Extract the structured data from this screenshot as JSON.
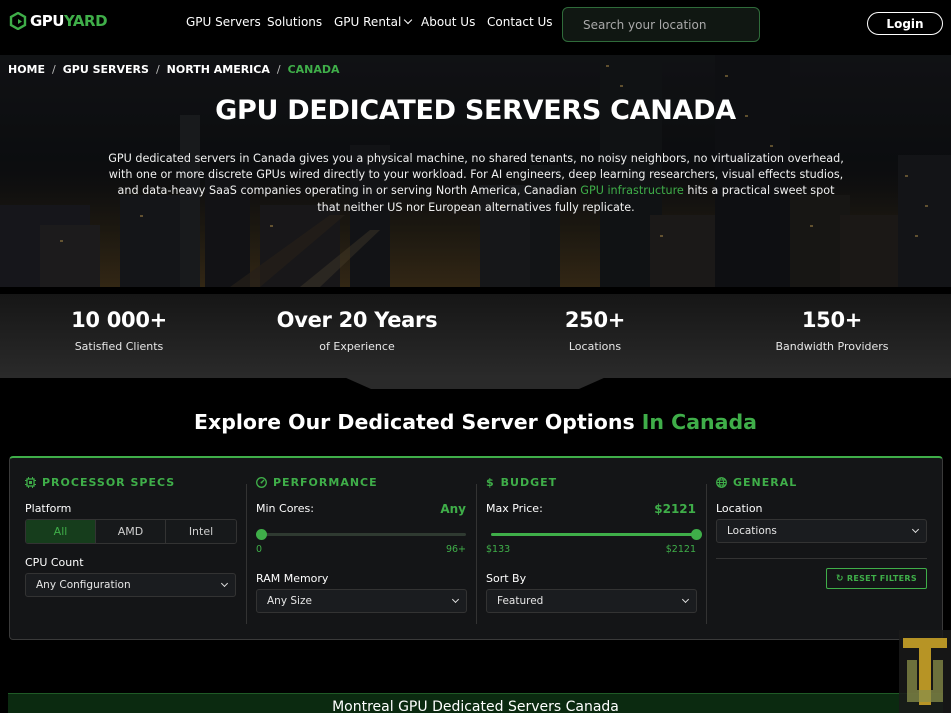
{
  "nav": {
    "logo": {
      "part1": "GPU",
      "part2": "YARD"
    },
    "menu": [
      "GPU Servers",
      "Solutions",
      "GPU Rental",
      "About Us",
      "Contact Us"
    ],
    "search_placeholder": "Search your location",
    "login_label": "Login"
  },
  "breadcrumb": [
    "HOME",
    "GPU SERVERS",
    "NORTH AMERICA",
    "CANADA"
  ],
  "hero": {
    "title": "GPU DEDICATED SERVERS CANADA",
    "desc_before": "GPU dedicated servers in Canada gives you a physical machine, no shared tenants, no noisy neighbors, no virtualization overhead, with one or more discrete GPUs wired directly to your workload. For AI engineers, deep learning researchers, visual effects studios, and data-heavy SaaS companies operating in or serving North America, Canadian ",
    "desc_link": "GPU infrastructure",
    "desc_after": " hits a practical sweet spot that neither US nor European alternatives fully replicate."
  },
  "stats": [
    {
      "value": "10 000+",
      "label": "Satisfied Clients"
    },
    {
      "value": "Over 20 Years",
      "label": "of Experience"
    },
    {
      "value": "250+",
      "label": "Locations"
    },
    {
      "value": "150+",
      "label": "Bandwidth Providers"
    }
  ],
  "explore": {
    "title": "Explore Our Dedicated Server Options",
    "accent": "In Canada"
  },
  "filters": {
    "processor": {
      "heading": "PROCESSOR SPECS",
      "platform_label": "Platform",
      "platform_options": [
        "All",
        "AMD",
        "Intel"
      ],
      "platform_selected": "All",
      "cpu_label": "CPU Count",
      "cpu_value": "Any Configuration"
    },
    "performance": {
      "heading": "PERFORMANCE",
      "cores_label": "Min Cores:",
      "cores_value": "Any",
      "cores_min": "0",
      "cores_max": "96+",
      "cores_level": 0,
      "ram_label": "RAM Memory",
      "ram_value": "Any Size"
    },
    "budget": {
      "heading": "BUDGET",
      "price_label": "Max Price:",
      "price_value": "$2121",
      "price_min": "$133",
      "price_max": "$2121",
      "price_level": 1,
      "sort_label": "Sort By",
      "sort_value": "Featured"
    },
    "general": {
      "heading": "GENERAL",
      "location_label": "Location",
      "location_value": "Locations",
      "reset_label": "RESET FILTERS"
    }
  },
  "city_banner": "Montreal GPU Dedicated Servers Canada",
  "colors": {
    "accent": "#3fae49",
    "background": "#000000",
    "panel": "#141517"
  },
  "icons": [
    "gpuyard-logo-icon",
    "chevron-down-icon",
    "cpu-icon",
    "gauge-icon",
    "dollar-icon",
    "globe-icon",
    "reset-icon"
  ]
}
